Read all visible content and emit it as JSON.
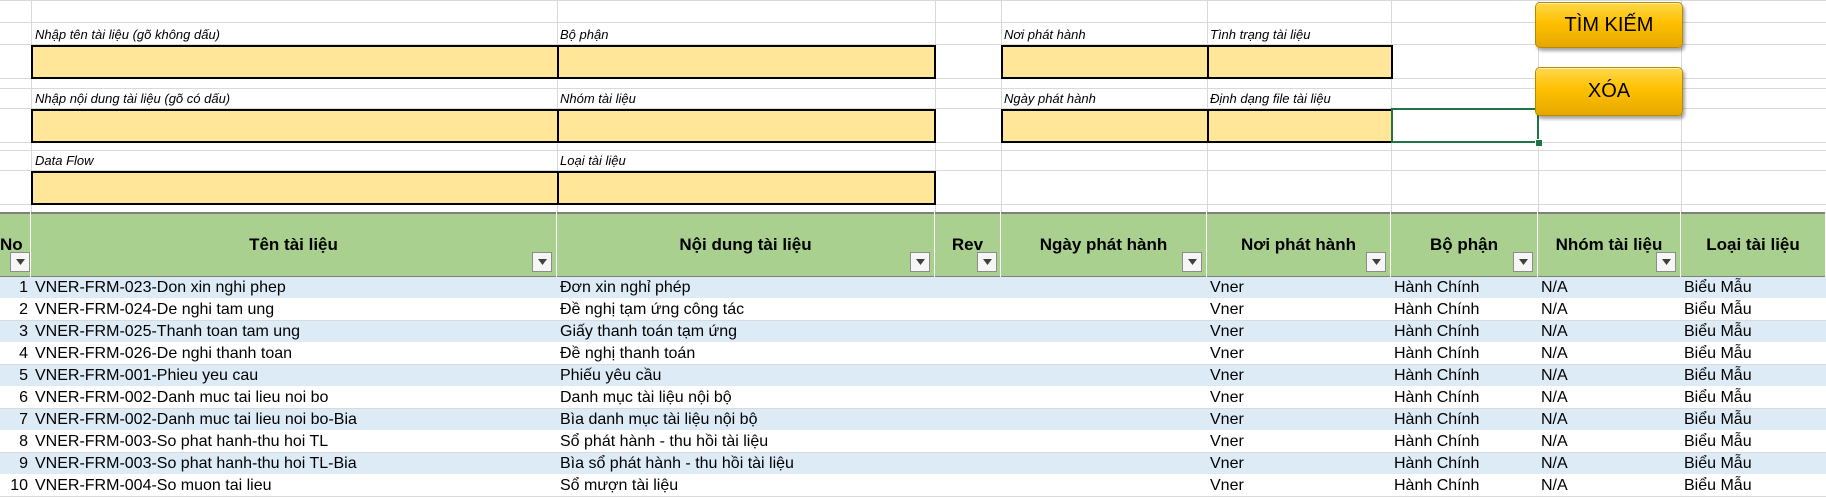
{
  "form": {
    "ten_label": "Nhập tên tài liệu (gõ không dấu)",
    "noidung_label": "Nhập nội dung tài liệu (gõ có dấu)",
    "dataflow_label": "Data Flow",
    "bophan_label": "Bộ phận",
    "nhom_label": "Nhóm tài liệu",
    "loai_label": "Loại tài liệu",
    "noiph_label": "Nơi phát hành",
    "ngayph_label": "Ngày phát hành",
    "tinhtrang_label": "Tình trạng tài liệu",
    "dinhdang_label": "Định dạng file tài liệu"
  },
  "buttons": {
    "search": "TÌM KIẾM",
    "clear": "XÓA"
  },
  "colors": {
    "input_fill": "#ffe699",
    "header_fill": "#a9d08e",
    "band_fill": "#ddebf7",
    "button_fill": "#ffc000",
    "selection": "#217346"
  },
  "table": {
    "headers": [
      "No",
      "Tên tài liệu",
      "Nội dung tài liệu",
      "Rev",
      "Ngày phát hành",
      "Nơi phát hành",
      "Bộ phận",
      "Nhóm tài liệu",
      "Loại tài liệu"
    ],
    "rows": [
      [
        "1",
        "VNER-FRM-023-Don xin nghi phep",
        "Đơn xin nghỉ phép",
        "",
        "",
        "Vner",
        "Hành Chính",
        "N/A",
        "Biểu Mẫu"
      ],
      [
        "2",
        "VNER-FRM-024-De nghi tam ung",
        "Đề nghị tạm ứng công tác",
        "",
        "",
        "Vner",
        "Hành Chính",
        "N/A",
        "Biểu Mẫu"
      ],
      [
        "3",
        "VNER-FRM-025-Thanh toan tam ung",
        "Giấy thanh toán tạm ứng",
        "",
        "",
        "Vner",
        "Hành Chính",
        "N/A",
        "Biểu Mẫu"
      ],
      [
        "4",
        "VNER-FRM-026-De nghi thanh toan",
        "Đề nghị thanh toán",
        "",
        "",
        "Vner",
        "Hành Chính",
        "N/A",
        "Biểu Mẫu"
      ],
      [
        "5",
        "VNER-FRM-001-Phieu yeu cau",
        "Phiếu yêu cầu",
        "",
        "",
        "Vner",
        "Hành Chính",
        "N/A",
        "Biểu Mẫu"
      ],
      [
        "6",
        "VNER-FRM-002-Danh muc tai lieu noi bo",
        "Danh mục tài liệu nội bộ",
        "",
        "",
        "Vner",
        "Hành Chính",
        "N/A",
        "Biểu Mẫu"
      ],
      [
        "7",
        "VNER-FRM-002-Danh muc tai lieu noi bo-Bia",
        "Bìa danh mục tài liệu nội bộ",
        "",
        "",
        "Vner",
        "Hành Chính",
        "N/A",
        "Biểu Mẫu"
      ],
      [
        "8",
        "VNER-FRM-003-So phat hanh-thu hoi TL",
        "Sổ phát hành - thu hồi tài liệu",
        "",
        "",
        "Vner",
        "Hành Chính",
        "N/A",
        "Biểu Mẫu"
      ],
      [
        "9",
        "VNER-FRM-003-So phat hanh-thu hoi TL-Bia",
        "Bìa sổ phát hành - thu hồi tài liệu",
        "",
        "",
        "Vner",
        "Hành Chính",
        "N/A",
        "Biểu Mẫu"
      ],
      [
        "10",
        "VNER-FRM-004-So muon tai lieu",
        "Sổ mượn tài liệu",
        "",
        "",
        "Vner",
        "Hành Chính",
        "N/A",
        "Biểu Mẫu"
      ]
    ]
  }
}
